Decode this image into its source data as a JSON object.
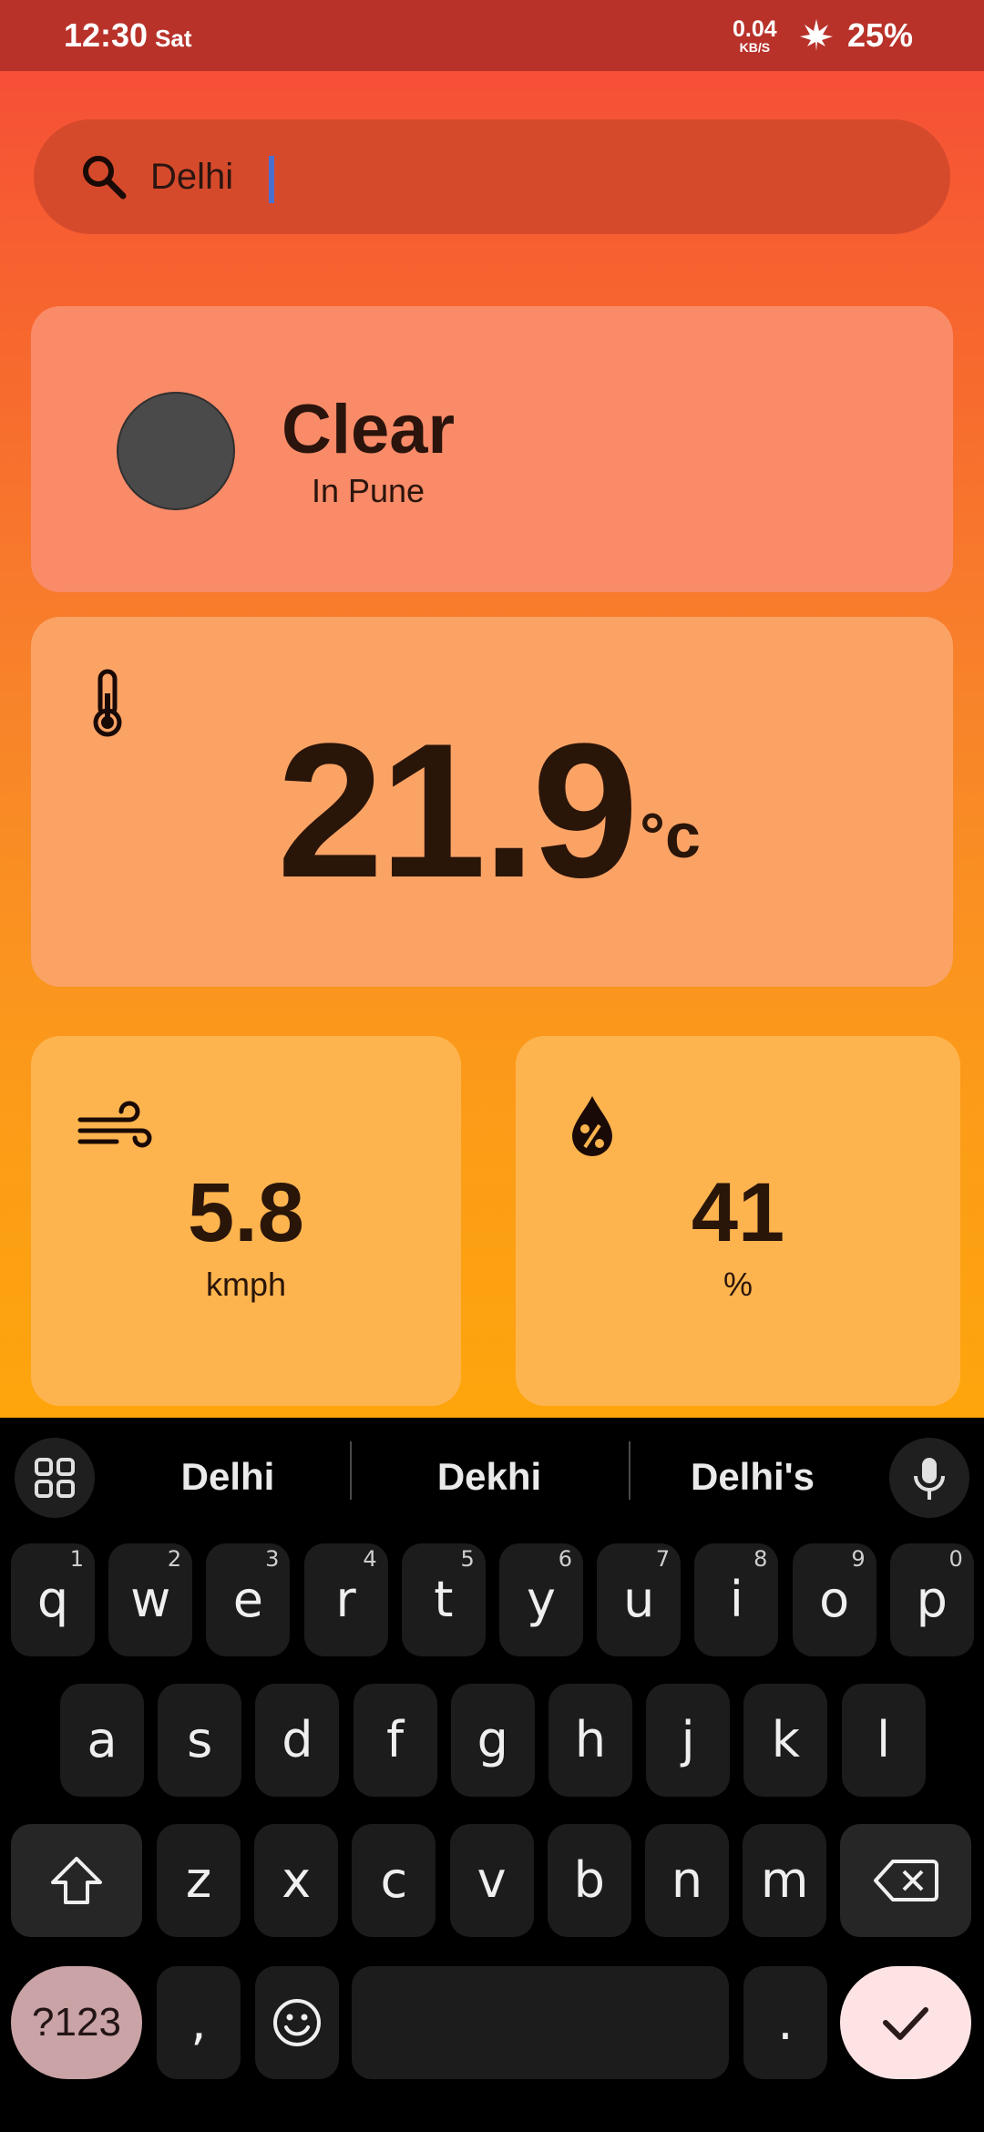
{
  "status_bar": {
    "time": "12:30",
    "day": "Sat",
    "net_rate": "0.04",
    "net_unit": "KB/S",
    "battery": "25%"
  },
  "search": {
    "value": "Delhi",
    "placeholder": ""
  },
  "condition": {
    "title": "Clear",
    "location": "In Pune"
  },
  "temperature": {
    "value": "21.9",
    "unit": "°c"
  },
  "wind": {
    "value": "5.8",
    "unit": "kmph"
  },
  "humidity": {
    "value": "41",
    "unit": "%"
  },
  "keyboard": {
    "suggestions": [
      "Delhi",
      "Dekhi",
      "Delhi's"
    ],
    "row1": [
      {
        "k": "q",
        "h": "1"
      },
      {
        "k": "w",
        "h": "2"
      },
      {
        "k": "e",
        "h": "3"
      },
      {
        "k": "r",
        "h": "4"
      },
      {
        "k": "t",
        "h": "5"
      },
      {
        "k": "y",
        "h": "6"
      },
      {
        "k": "u",
        "h": "7"
      },
      {
        "k": "i",
        "h": "8"
      },
      {
        "k": "o",
        "h": "9"
      },
      {
        "k": "p",
        "h": "0"
      }
    ],
    "row2": [
      "a",
      "s",
      "d",
      "f",
      "g",
      "h",
      "j",
      "k",
      "l"
    ],
    "row3": [
      "z",
      "x",
      "c",
      "v",
      "b",
      "n",
      "m"
    ],
    "symbols_label": "?123",
    "comma": ",",
    "period": "."
  },
  "colors": {
    "status_bar": "#b8322a",
    "gradient_top": "#f6493a",
    "gradient_bottom": "#fea50c",
    "card_condition": "#f98b68",
    "card_temperature": "#fba365",
    "card_small": "#feb44e",
    "weather_circle": "#4a4a4a"
  }
}
